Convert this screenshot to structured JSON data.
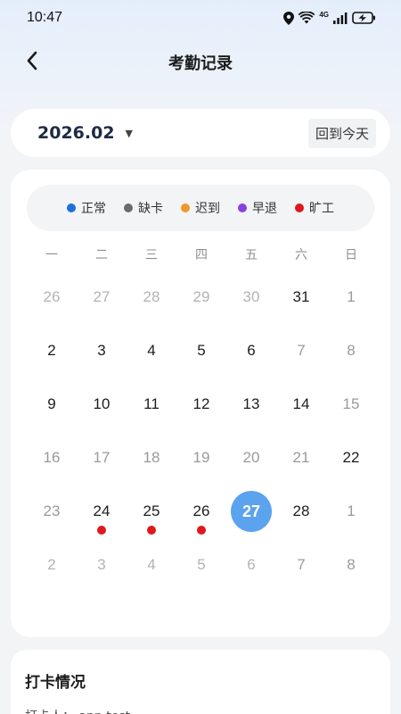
{
  "status_bar": {
    "time": "10:47",
    "network": "4G",
    "icons": [
      "location-icon",
      "wifi-icon",
      "signal-icon",
      "battery-charging-icon"
    ]
  },
  "header": {
    "title": "考勤记录",
    "back_icon": "chevron-left-icon"
  },
  "month_selector": {
    "value": "2026.02",
    "caret": "▼",
    "today_label": "回到今天"
  },
  "legend": [
    {
      "label": "正常",
      "color": "#1e6fd9"
    },
    {
      "label": "缺卡",
      "color": "#6b6b6b"
    },
    {
      "label": "迟到",
      "color": "#f0962a"
    },
    {
      "label": "早退",
      "color": "#8a3fe0"
    },
    {
      "label": "旷工",
      "color": "#e0181d"
    }
  ],
  "weekdays": [
    "一",
    "二",
    "三",
    "四",
    "五",
    "六",
    "日"
  ],
  "days": [
    {
      "day": "26",
      "state": "muted"
    },
    {
      "day": "27",
      "state": "muted"
    },
    {
      "day": "28",
      "state": "muted"
    },
    {
      "day": "29",
      "state": "muted"
    },
    {
      "day": "30",
      "state": "muted"
    },
    {
      "day": "31",
      "state": "current"
    },
    {
      "day": "1",
      "state": "weekend"
    },
    {
      "day": "2",
      "state": "current"
    },
    {
      "day": "3",
      "state": "current"
    },
    {
      "day": "4",
      "state": "current"
    },
    {
      "day": "5",
      "state": "current"
    },
    {
      "day": "6",
      "state": "current"
    },
    {
      "day": "7",
      "state": "weekend"
    },
    {
      "day": "8",
      "state": "weekend"
    },
    {
      "day": "9",
      "state": "current"
    },
    {
      "day": "10",
      "state": "current"
    },
    {
      "day": "11",
      "state": "current"
    },
    {
      "day": "12",
      "state": "current"
    },
    {
      "day": "13",
      "state": "current"
    },
    {
      "day": "14",
      "state": "current"
    },
    {
      "day": "15",
      "state": "weekend"
    },
    {
      "day": "16",
      "state": "weekend"
    },
    {
      "day": "17",
      "state": "weekend"
    },
    {
      "day": "18",
      "state": "weekend"
    },
    {
      "day": "19",
      "state": "weekend"
    },
    {
      "day": "20",
      "state": "weekend"
    },
    {
      "day": "21",
      "state": "weekend"
    },
    {
      "day": "22",
      "state": "current"
    },
    {
      "day": "23",
      "state": "weekend"
    },
    {
      "day": "24",
      "state": "current",
      "mark": "#e0181d"
    },
    {
      "day": "25",
      "state": "current",
      "mark": "#e0181d"
    },
    {
      "day": "26",
      "state": "current",
      "mark": "#e0181d"
    },
    {
      "day": "27",
      "state": "today"
    },
    {
      "day": "28",
      "state": "current"
    },
    {
      "day": "1",
      "state": "weekend"
    },
    {
      "day": "2",
      "state": "muted"
    },
    {
      "day": "3",
      "state": "muted"
    },
    {
      "day": "4",
      "state": "muted"
    },
    {
      "day": "5",
      "state": "muted"
    },
    {
      "day": "6",
      "state": "muted"
    },
    {
      "day": "7",
      "state": "weekend"
    },
    {
      "day": "8",
      "state": "weekend"
    }
  ],
  "record": {
    "title": "打卡情况",
    "line": "打卡人： app test"
  }
}
